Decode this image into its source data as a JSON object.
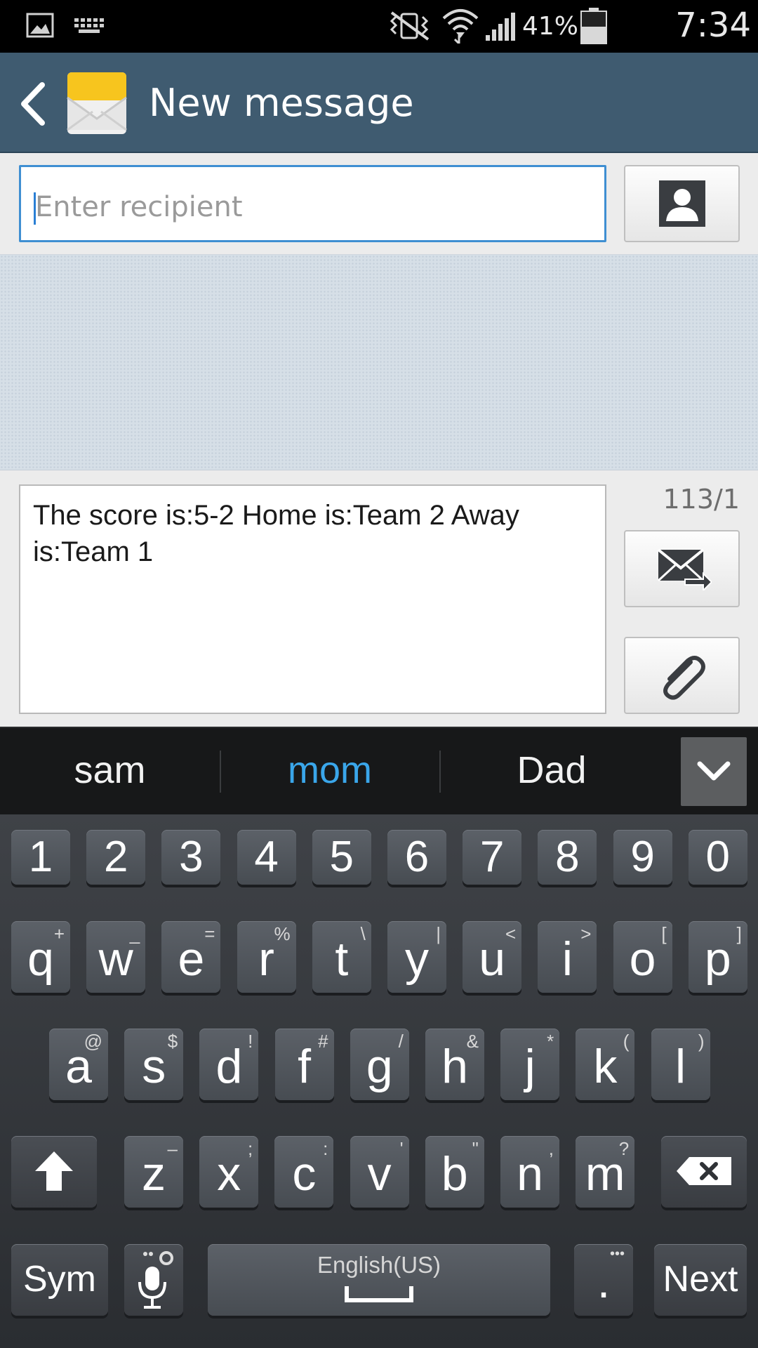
{
  "status_bar": {
    "battery_percent": "41%",
    "time": "7:34 PM",
    "icons": [
      "gallery-notification-icon",
      "keyboard-notification-icon",
      "vibrate-mute-icon",
      "wifi-icon",
      "signal-icon",
      "battery-icon"
    ]
  },
  "action_bar": {
    "title": "New message",
    "back_icon": "chevron-left-icon",
    "app_icon": "envelope-icon"
  },
  "recipient": {
    "placeholder": "Enter recipient",
    "value": "",
    "contact_button_icon": "contact-icon"
  },
  "composer": {
    "message": "The score is:5-2 Home is:Team 2 Away is:Team 1",
    "char_counter": "113/1",
    "send_icon": "send-message-icon",
    "attach_icon": "paperclip-icon"
  },
  "suggestions": {
    "items": [
      {
        "label": "sam",
        "highlighted": false
      },
      {
        "label": "mom",
        "highlighted": true
      },
      {
        "label": "Dad",
        "highlighted": false
      }
    ],
    "highlight_color": "#3aa6ea",
    "collapse_icon": "chevron-down-icon"
  },
  "keyboard": {
    "row_numbers": [
      "1",
      "2",
      "3",
      "4",
      "5",
      "6",
      "7",
      "8",
      "9",
      "0"
    ],
    "row_qwerty": [
      {
        "main": "q",
        "sec": "+"
      },
      {
        "main": "w",
        "sec": "_"
      },
      {
        "main": "e",
        "sec": "="
      },
      {
        "main": "r",
        "sec": "%"
      },
      {
        "main": "t",
        "sec": "\\"
      },
      {
        "main": "y",
        "sec": "|"
      },
      {
        "main": "u",
        "sec": "<"
      },
      {
        "main": "i",
        "sec": ">"
      },
      {
        "main": "o",
        "sec": "["
      },
      {
        "main": "p",
        "sec": "]"
      }
    ],
    "row_asdf": [
      {
        "main": "a",
        "sec": "@"
      },
      {
        "main": "s",
        "sec": "$"
      },
      {
        "main": "d",
        "sec": "!"
      },
      {
        "main": "f",
        "sec": "#"
      },
      {
        "main": "g",
        "sec": "/"
      },
      {
        "main": "h",
        "sec": "&"
      },
      {
        "main": "j",
        "sec": "*"
      },
      {
        "main": "k",
        "sec": "("
      },
      {
        "main": "l",
        "sec": ")"
      }
    ],
    "row_zxcv": [
      {
        "main": "z",
        "sec": "–"
      },
      {
        "main": "x",
        "sec": ";"
      },
      {
        "main": "c",
        "sec": ":"
      },
      {
        "main": "v",
        "sec": "'"
      },
      {
        "main": "b",
        "sec": "\""
      },
      {
        "main": "n",
        "sec": ","
      },
      {
        "main": "m",
        "sec": "?"
      }
    ],
    "shift_icon": "shift-arrow-icon",
    "backspace_icon": "backspace-icon",
    "sym_label": "Sym",
    "mic_icon": "microphone-settings-icon",
    "space_label": "English(US)",
    "period_label": ".",
    "period_more": "•••",
    "next_label": "Next"
  }
}
